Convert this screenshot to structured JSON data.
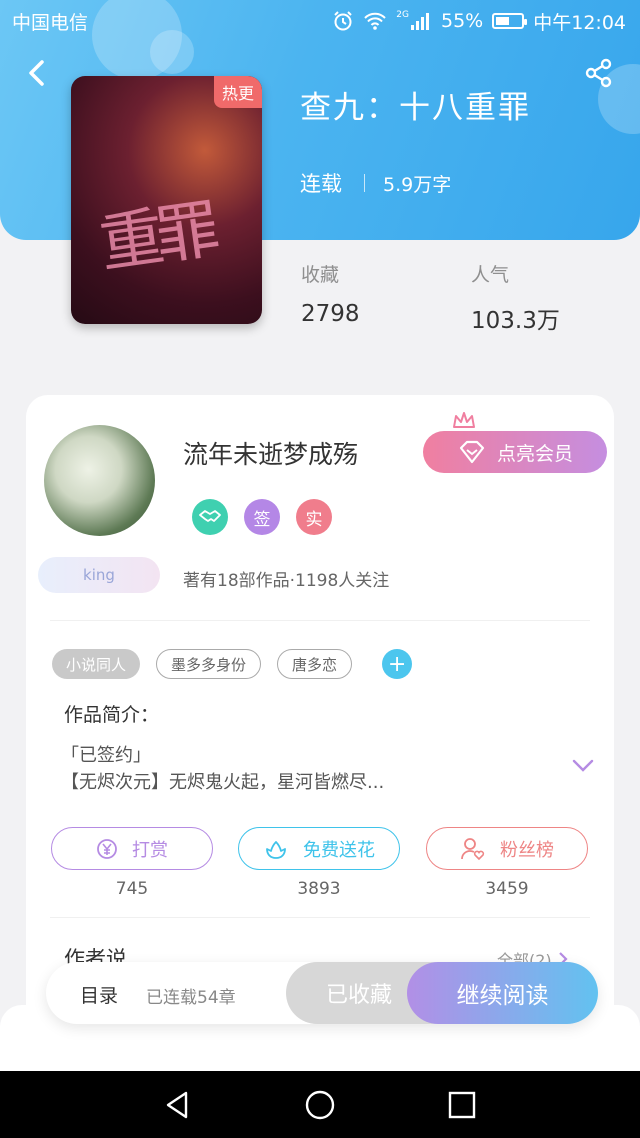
{
  "status_bar": {
    "carrier": "中国电信",
    "network": "2G",
    "battery": "55%",
    "battery_level": 0.55,
    "time": "中午12:04"
  },
  "header": {
    "cover_badge": "热更",
    "cover_art_text": "重罪",
    "title": "查九：十八重罪",
    "status": "连载",
    "word_count": "5.9万字",
    "stats": [
      {
        "label": "收藏",
        "value": "2798"
      },
      {
        "label": "人气",
        "value": "103.3万"
      }
    ]
  },
  "author": {
    "name": "流年未逝梦成殇",
    "vip_button": "点亮会员",
    "badges": [
      {
        "text": "签",
        "color": "#b487e6"
      },
      {
        "text": "实",
        "color": "#f07d8c"
      }
    ],
    "handshake_color": "#3fd0b0",
    "level_badge": "king",
    "works_info": "著有18部作品·1198人关注"
  },
  "tags": [
    "小说同人",
    "墨多多身份",
    "唐多恋"
  ],
  "intro": {
    "title": "作品简介：",
    "line1": "「已签约」",
    "line2": "【无烬次元】无烬鬼火起，星河皆燃尽..."
  },
  "actions": [
    {
      "label": "打赏",
      "count": "745",
      "color": "#b58be3"
    },
    {
      "label": "免费送花",
      "count": "3893",
      "color": "#3fc3ea"
    },
    {
      "label": "粉丝榜",
      "count": "3459",
      "color": "#ee8585"
    }
  ],
  "author_says": {
    "title": "作者说",
    "all_link": "全部(2)"
  },
  "bottom_bar": {
    "toc": "目录",
    "chapters": "已连载54章",
    "collected": "已收藏",
    "continue": "继续阅读"
  }
}
